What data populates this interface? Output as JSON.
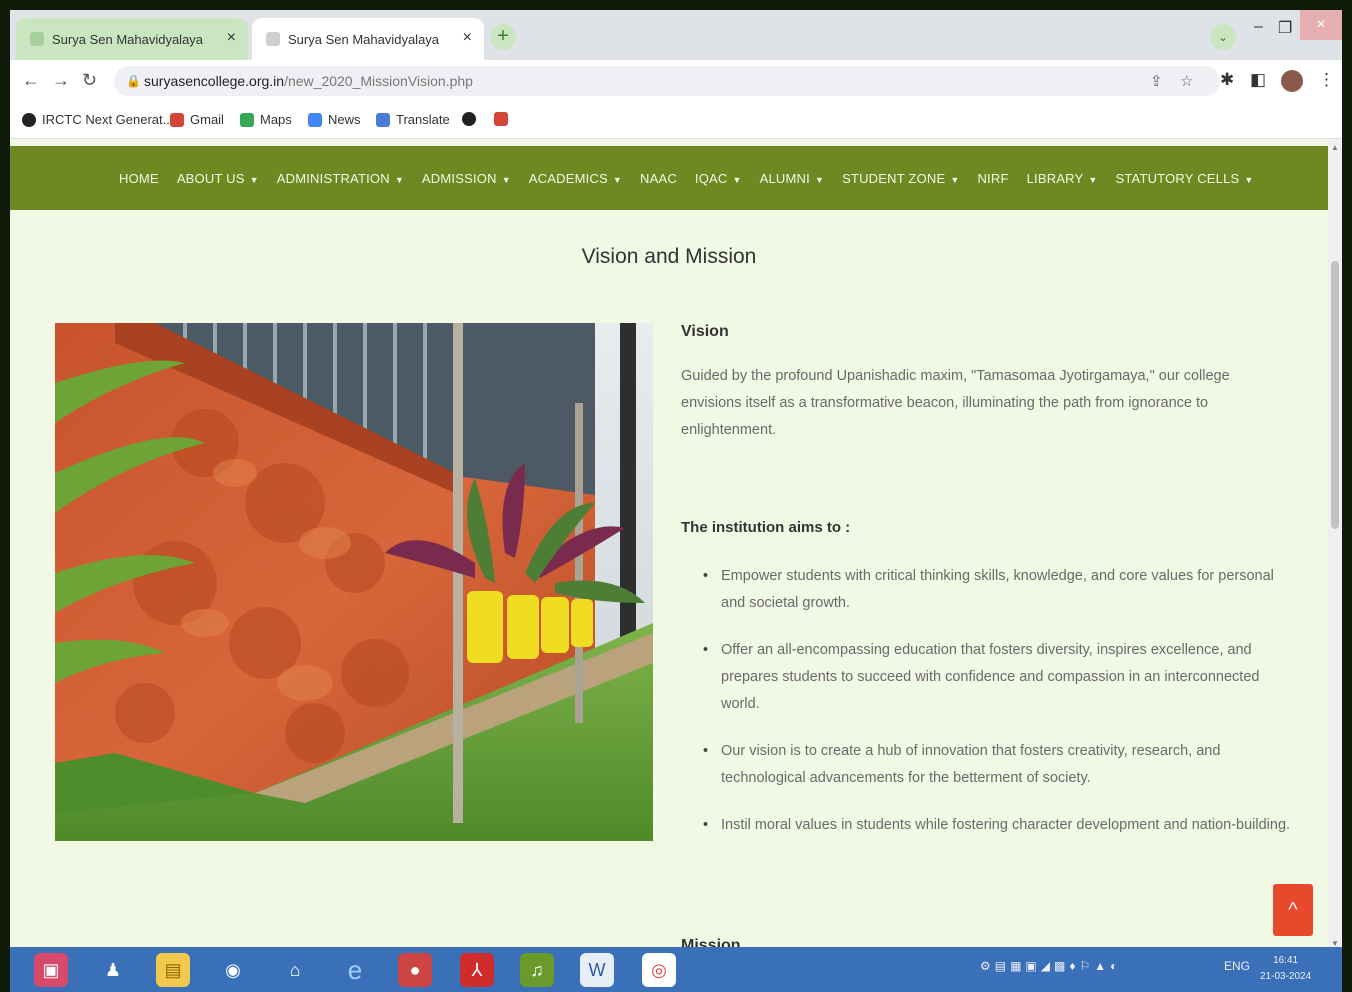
{
  "browser": {
    "tabs": [
      {
        "label": "Surya Sen Mahavidyalaya",
        "close": "×"
      },
      {
        "label": "Surya Sen Mahavidyalaya",
        "close": "×"
      }
    ],
    "new_tab": "+",
    "window_controls": {
      "minimize": "–",
      "maximize": "❐",
      "close": "×"
    },
    "url_host": "suryasencollege.org.in",
    "url_path": "/new_2020_MissionVision.php",
    "bookmarks": [
      {
        "label": "IRCTC Next Generat...",
        "icon": "globe-icon"
      },
      {
        "label": "Gmail",
        "icon": "gmail-icon"
      },
      {
        "label": "Maps",
        "icon": "maps-icon"
      },
      {
        "label": "News",
        "icon": "news-icon"
      },
      {
        "label": "Translate",
        "icon": "translate-icon"
      },
      {
        "label": "",
        "icon": "globe-icon"
      },
      {
        "label": "",
        "icon": "gmail-icon"
      }
    ]
  },
  "nav": {
    "items": [
      {
        "label": "HOME",
        "caret": ""
      },
      {
        "label": "ABOUT US",
        "caret": "▼"
      },
      {
        "label": "ADMINISTRATION",
        "caret": "▼"
      },
      {
        "label": "ADMISSION",
        "caret": "▼"
      },
      {
        "label": "ACADEMICS",
        "caret": "▼"
      },
      {
        "label": "NAAC",
        "caret": ""
      },
      {
        "label": "IQAC",
        "caret": "▼"
      },
      {
        "label": "ALUMNI",
        "caret": "▼"
      },
      {
        "label": "STUDENT ZONE",
        "caret": "▼"
      },
      {
        "label": "NIRF",
        "caret": ""
      },
      {
        "label": "LIBRARY",
        "caret": "▼"
      },
      {
        "label": "STATUTORY CELLS",
        "caret": "▼"
      }
    ]
  },
  "page": {
    "title": "Vision and Mission",
    "vision_heading": "Vision",
    "vision_text": "Guided by the profound Upanishadic maxim, \"Tamasomaa Jyotirgamaya,\" our college envisions itself as a transformative beacon, illuminating the path from ignorance to enlightenment.",
    "aims_heading": "The institution aims to :",
    "aims": [
      "Empower students with critical thinking skills, knowledge, and core values for personal and societal growth.",
      "Offer an all-encompassing education that fosters diversity, inspires excellence, and prepares students to succeed with confidence and compassion in an interconnected world.",
      "Our vision is to create a hub of innovation that fosters creativity, research, and technological advancements for the betterment of society.",
      "Instil moral values in students while fostering character development and nation-building."
    ],
    "mission_heading": "Mission",
    "back_to_top": "^"
  },
  "taskbar": {
    "language": "ENG",
    "time": "16:41",
    "date": "21-03-2024"
  },
  "colors": {
    "menu_bar": "#6d8a22",
    "page_bg": "#f1f8e4",
    "back_to_top": "#e8482c",
    "taskbar": "#3a70b8"
  }
}
